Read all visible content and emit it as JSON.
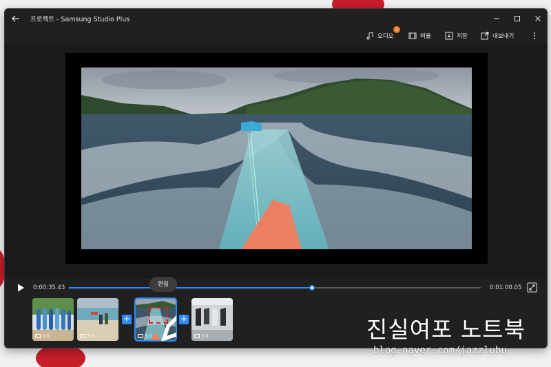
{
  "window": {
    "title": "프로젝트 - Samsung Studio Plus"
  },
  "toolbar": {
    "audio_label": "오디오",
    "audio_badge": "1",
    "ratio_label": "비율",
    "save_label": "저장",
    "export_label": "내보내기"
  },
  "player": {
    "current_time": "0:00:35.43",
    "total_time": "0:01:00.05",
    "progress": 0.59,
    "tooltip": "편집"
  },
  "clips": [
    {
      "name": "surfboards",
      "duration": "3.0",
      "selected": false
    },
    {
      "name": "beach-people",
      "duration": "3.0",
      "selected": false
    },
    {
      "name": "boat-wake",
      "duration": "3.0",
      "selected": true
    },
    {
      "name": "shop-clothes",
      "duration": "3.0",
      "selected": false
    }
  ],
  "watermark": {
    "text": "진실여포 노트북",
    "url": "blog.naver.com/jazzlubu"
  },
  "colors": {
    "accent": "#2f8af5",
    "badge": "#f07a20",
    "window_bg": "#202020",
    "highlight": "#e02020"
  }
}
